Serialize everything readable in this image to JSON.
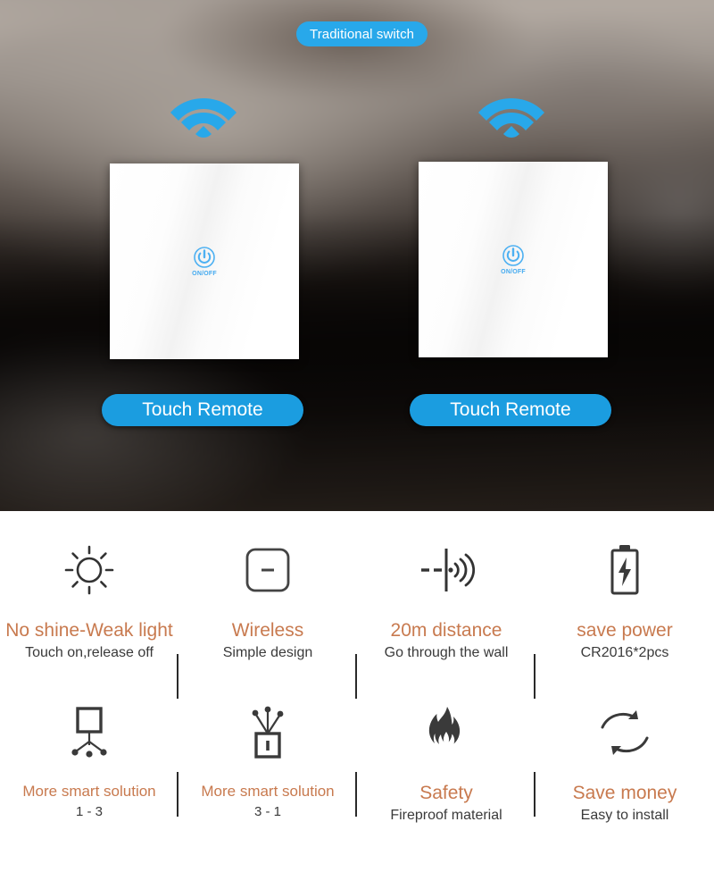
{
  "hero": {
    "traditional_pill": "Traditional switch",
    "wifi_icon_left": "wifi-icon",
    "wifi_icon_right": "wifi-icon",
    "switch_left": {
      "onoff_label": "ON/OFF",
      "power_icon": "power-icon"
    },
    "switch_right": {
      "onoff_label": "ON/OFF",
      "power_icon": "power-icon"
    },
    "touch_pill_left": "Touch Remote",
    "touch_pill_right": "Touch Remote",
    "accent_blue": "#28a8ea",
    "button_blue": "#1b9de0"
  },
  "features": {
    "title_color": "#c87a4f",
    "sub_color": "#3a3a3a",
    "row1": [
      {
        "icon": "sun-icon",
        "title": "No shine-Weak light",
        "sub": "Touch on,release off"
      },
      {
        "icon": "panel-dash-icon",
        "title": "Wireless",
        "sub": "Simple design"
      },
      {
        "icon": "through-wall-signal-icon",
        "title": "20m distance",
        "sub": "Go through the wall"
      },
      {
        "icon": "battery-bolt-icon",
        "title": "save power",
        "sub": "CR2016*2pcs"
      }
    ],
    "row2": [
      {
        "icon": "one-to-three-icon",
        "title": "More smart solution",
        "sub": "1 - 3"
      },
      {
        "icon": "three-to-one-icon",
        "title": "More smart solution",
        "sub": "3 - 1"
      },
      {
        "icon": "flame-icon",
        "title": "Safety",
        "sub": "Fireproof material"
      },
      {
        "icon": "cycle-arrows-icon",
        "title": "Save money",
        "sub": "Easy to install"
      }
    ]
  }
}
